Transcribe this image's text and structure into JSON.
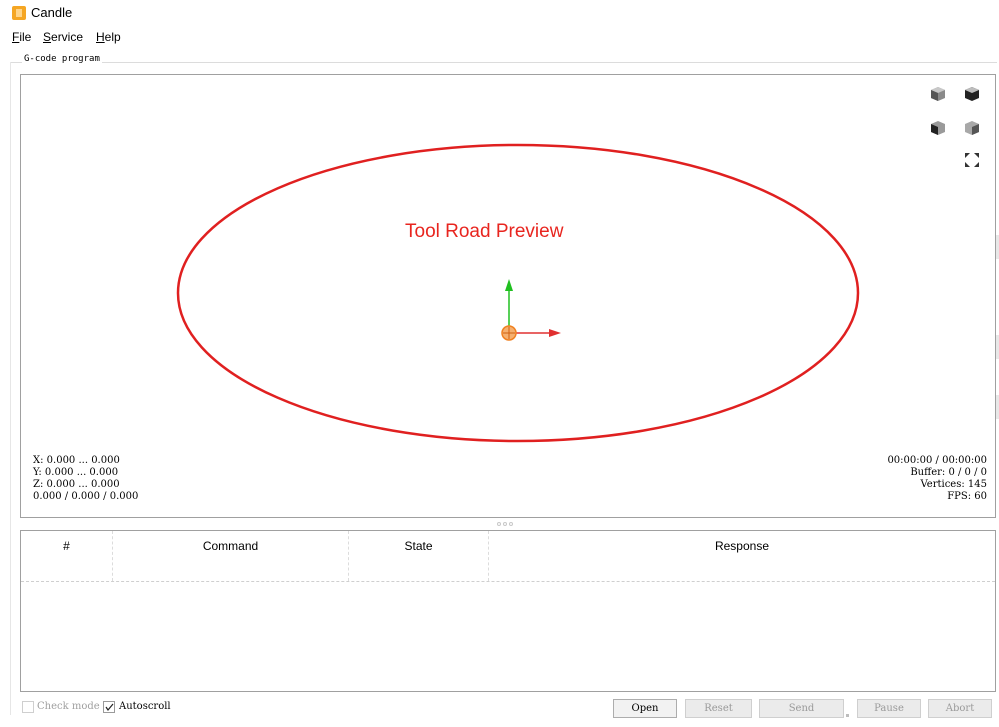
{
  "app": {
    "title": "Candle",
    "icon": "candle-app-icon"
  },
  "menu": [
    {
      "label": "File",
      "mnemonic": "F",
      "rest": "ile"
    },
    {
      "label": "Service",
      "mnemonic": "S",
      "rest": "ervice"
    },
    {
      "label": "Help",
      "mnemonic": "H",
      "rest": "elp"
    }
  ],
  "gcode_group": {
    "label": "G-code program"
  },
  "viewport": {
    "annotation": "Tool Road Preview",
    "annotation_color": "#e8251f",
    "ellipse_color": "#e02020",
    "axis_x_color": "#e03030",
    "axis_y_color": "#20c020",
    "tool_color": "#f08020",
    "view_buttons": [
      {
        "name": "view-isometric-icon"
      },
      {
        "name": "view-top-icon"
      },
      {
        "name": "view-front-icon"
      },
      {
        "name": "view-left-icon"
      },
      {
        "name": "fit-view-icon"
      }
    ],
    "info_left": [
      "X: 0.000 ... 0.000",
      "Y: 0.000 ... 0.000",
      "Z: 0.000 ... 0.000",
      "0.000 / 0.000 / 0.000"
    ],
    "info_right": [
      "00:00:00 / 00:00:00",
      "Buffer: 0 / 0 / 0",
      "Vertices: 145",
      "FPS: 60"
    ]
  },
  "console": {
    "columns": [
      "#",
      "Command",
      "State",
      "Response"
    ]
  },
  "bottom": {
    "check_mode": {
      "label": "Check mode",
      "checked": false,
      "enabled": false
    },
    "autoscroll": {
      "label": "Autoscroll",
      "checked": true,
      "enabled": true
    },
    "buttons": [
      {
        "label": "Open",
        "enabled": true
      },
      {
        "label": "Reset",
        "enabled": false
      },
      {
        "label": "Send",
        "enabled": false
      },
      {
        "label": "Pause",
        "enabled": false
      },
      {
        "label": "Abort",
        "enabled": false
      }
    ]
  }
}
